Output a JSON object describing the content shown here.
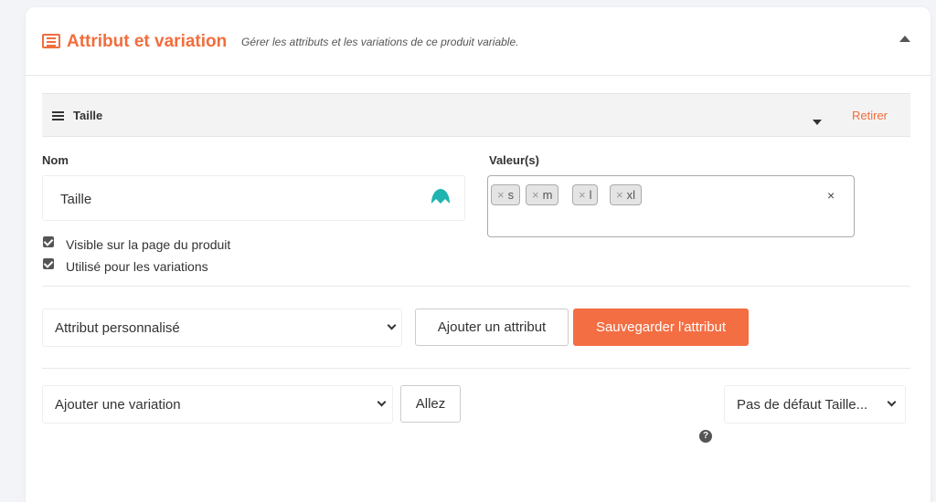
{
  "panel": {
    "title": "Attribut et variation",
    "subtitle": "Gérer les attributs et les variations de ce produit variable."
  },
  "attribute": {
    "name": "Taille",
    "remove_label": "Retirer",
    "name_label": "Nom",
    "name_value": "Taille",
    "values_label": "Valeur(s)",
    "values": [
      "s",
      "m",
      "l",
      "xl"
    ],
    "tag_remove": "×",
    "clear_all": "×",
    "visible_label": "Visible sur la page du produit",
    "visible_checked": true,
    "variations_label": "Utilisé pour les variations",
    "variations_checked": true
  },
  "attribute_actions": {
    "select_value": "Attribut personnalisé",
    "add_label": "Ajouter un attribut",
    "save_label": "Sauvegarder l'attribut"
  },
  "variation_actions": {
    "select_value": "Ajouter une variation",
    "go_label": "Allez",
    "default_value": "Pas de défaut Taille...",
    "help_glyph": "?"
  },
  "colors": {
    "accent": "#f26d3d",
    "primary_button": "#f36e43",
    "extension_icon": "#1fb4b0"
  }
}
